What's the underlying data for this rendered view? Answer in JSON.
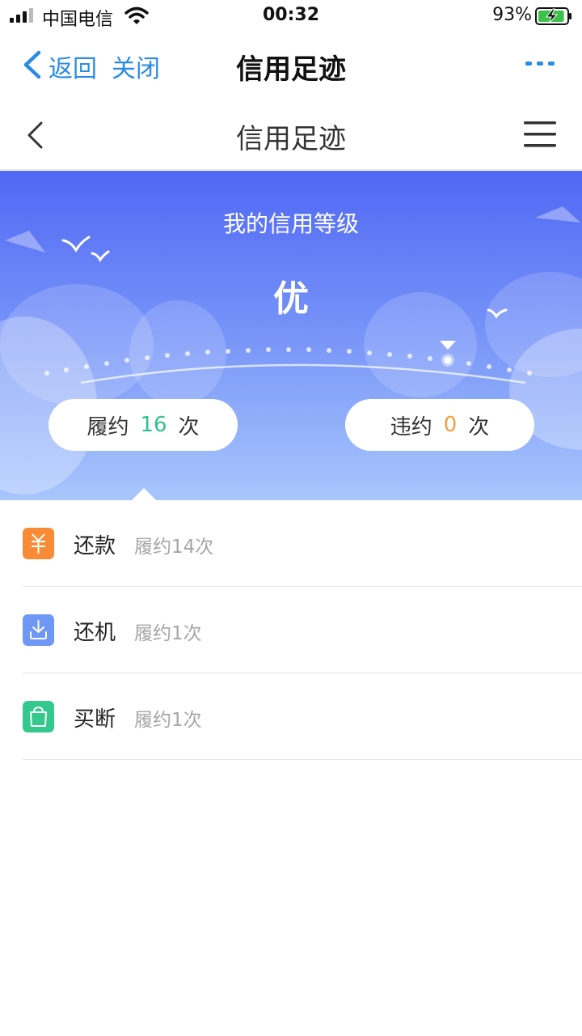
{
  "status_bar": {
    "carrier": "中国电信",
    "time": "00:32",
    "battery_percent": "93%",
    "battery_level": 0.93
  },
  "nav_outer": {
    "back_label": "返回",
    "close_label": "关闭",
    "title": "信用足迹",
    "more_icon": "more-dots-icon"
  },
  "nav_inner": {
    "title": "信用足迹",
    "back_icon": "chevron-left-icon",
    "menu_icon": "hamburger-menu-icon"
  },
  "hero": {
    "title": "我的信用等级",
    "level": "优",
    "fulfilled": {
      "prefix": "履约",
      "count": "16",
      "suffix": "次"
    },
    "breached": {
      "prefix": "违约",
      "count": "0",
      "suffix": "次"
    }
  },
  "records": [
    {
      "icon": "yuan-icon",
      "color": "#f98b36",
      "label": "还款",
      "detail": "履约14次"
    },
    {
      "icon": "download-icon",
      "color": "#6f97f5",
      "label": "还机",
      "detail": "履约1次"
    },
    {
      "icon": "shopping-bag-icon",
      "color": "#34c98c",
      "label": "买断",
      "detail": "履约1次"
    }
  ]
}
